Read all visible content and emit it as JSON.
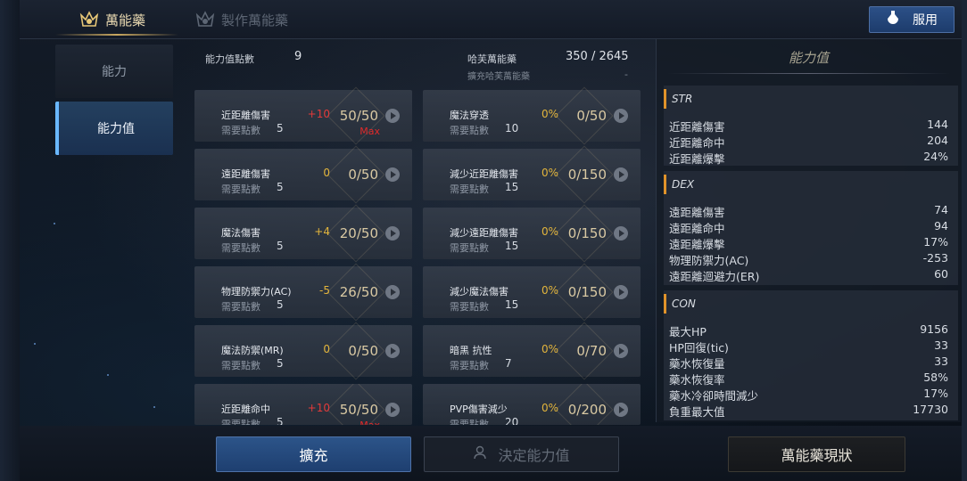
{
  "tabs": {
    "active": "萬能藥",
    "inactive": "製作萬能藥"
  },
  "use_button": "服用",
  "nav": {
    "ability": "能力",
    "stats": "能力值"
  },
  "header": {
    "points_label": "能力值點數",
    "points_value": "9",
    "elixir_label": "哈芙萬能藥",
    "elixir_value": "350 / 2645",
    "elixir_sub_label": "擴充哈芙萬能藥",
    "elixir_sub_value": "-"
  },
  "cards": [
    {
      "name": "近距離傷害",
      "req_label": "需要點數",
      "req": "5",
      "bonus": "+10",
      "bonus_color": "red",
      "progress": "50/50",
      "max": "Max"
    },
    {
      "name": "魔法穿透",
      "req_label": "需要點數",
      "req": "10",
      "bonus": "0%",
      "bonus_color": "gold",
      "progress": "0/50",
      "max": ""
    },
    {
      "name": "遠距離傷害",
      "req_label": "需要點數",
      "req": "5",
      "bonus": "0",
      "bonus_color": "gold",
      "progress": "0/50",
      "max": ""
    },
    {
      "name": "減少近距離傷害",
      "req_label": "需要點數",
      "req": "15",
      "bonus": "0%",
      "bonus_color": "gold",
      "progress": "0/150",
      "max": ""
    },
    {
      "name": "魔法傷害",
      "req_label": "需要點數",
      "req": "5",
      "bonus": "+4",
      "bonus_color": "gold",
      "progress": "20/50",
      "max": ""
    },
    {
      "name": "減少遠距離傷害",
      "req_label": "需要點數",
      "req": "15",
      "bonus": "0%",
      "bonus_color": "gold",
      "progress": "0/150",
      "max": ""
    },
    {
      "name": "物理防禦力(AC)",
      "req_label": "需要點數",
      "req": "5",
      "bonus": "-5",
      "bonus_color": "gold",
      "progress": "26/50",
      "max": ""
    },
    {
      "name": "減少魔法傷害",
      "req_label": "需要點數",
      "req": "15",
      "bonus": "0%",
      "bonus_color": "gold",
      "progress": "0/150",
      "max": ""
    },
    {
      "name": "魔法防禦(MR)",
      "req_label": "需要點數",
      "req": "5",
      "bonus": "0",
      "bonus_color": "gold",
      "progress": "0/50",
      "max": ""
    },
    {
      "name": "暗黑 抗性",
      "req_label": "需要點數",
      "req": "7",
      "bonus": "0%",
      "bonus_color": "gold",
      "progress": "0/70",
      "max": ""
    },
    {
      "name": "近距離命中",
      "req_label": "需要點數",
      "req": "5",
      "bonus": "+10",
      "bonus_color": "red",
      "progress": "50/50",
      "max": "Max"
    },
    {
      "name": "PVP傷害減少",
      "req_label": "需要點數",
      "req": "20",
      "bonus": "0%",
      "bonus_color": "gold",
      "progress": "0/200",
      "max": ""
    }
  ],
  "stats_panel": {
    "title": "能力值",
    "str": {
      "label": "STR",
      "rows": [
        {
          "k": "近距離傷害",
          "v": "144"
        },
        {
          "k": "近距離命中",
          "v": "204"
        },
        {
          "k": "近距離爆擊",
          "v": "24%"
        }
      ]
    },
    "dex": {
      "label": "DEX",
      "rows": [
        {
          "k": "遠距離傷害",
          "v": "74"
        },
        {
          "k": "遠距離命中",
          "v": "94"
        },
        {
          "k": "遠距離爆擊",
          "v": "17%"
        },
        {
          "k": "物理防禦力(AC)",
          "v": "-253"
        },
        {
          "k": "遠距離迴避力(ER)",
          "v": "60"
        }
      ]
    },
    "con": {
      "label": "CON",
      "rows": [
        {
          "k": "最大HP",
          "v": "9156"
        },
        {
          "k": "HP回復(tic)",
          "v": "33"
        },
        {
          "k": "藥水恢復量",
          "v": "33"
        },
        {
          "k": "藥水恢復率",
          "v": "58%"
        },
        {
          "k": "藥水冷卻時間減少",
          "v": "17%"
        },
        {
          "k": "負重最大值",
          "v": "17730"
        }
      ]
    }
  },
  "buttons": {
    "expand": "擴充",
    "decide": "決定能力值",
    "status": "萬能藥現狀"
  },
  "colors": {
    "red": "#e23a3a",
    "gold": "#e3b53c",
    "accent": "#6ab8ff"
  }
}
